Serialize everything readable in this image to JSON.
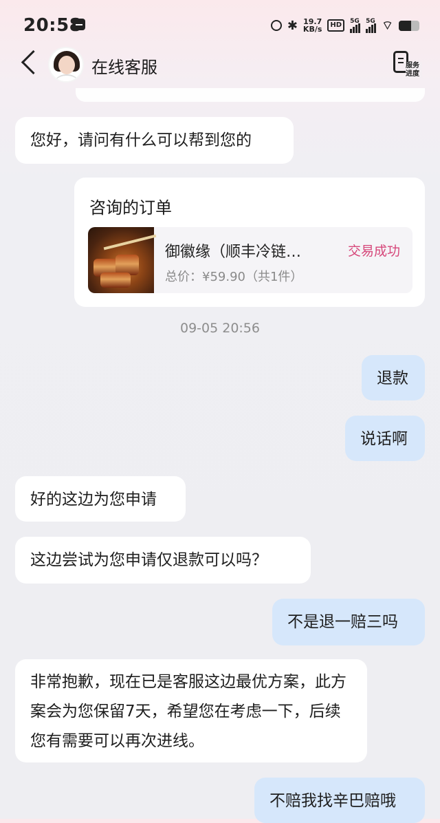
{
  "status_bar": {
    "time": "20:58",
    "net_speed": "19.7",
    "net_unit": "KB/s",
    "hd": "HD",
    "sim1": "5G",
    "sim2": "5G",
    "battery_level": 0.6
  },
  "header": {
    "title": "在线客服",
    "service_progress": "服务进度"
  },
  "messages": [
    {
      "side": "left",
      "text": "您好，请问有什么可以帮到您的"
    },
    {
      "side": "right",
      "text": "退款"
    },
    {
      "side": "right",
      "text": "说话啊"
    },
    {
      "side": "left",
      "text": "好的这边为您申请"
    },
    {
      "side": "left",
      "text": "这边尝试为您申请仅退款可以吗？"
    },
    {
      "side": "right",
      "text": "不是退一赔三吗"
    },
    {
      "side": "left",
      "text": "非常抱歉，现在已是客服这边最优方案，此方案会为您保留7天，希望您在考虑一下，后续您有需要可以再次进线。"
    },
    {
      "side": "right",
      "text": "不赔我找辛巴赔哦"
    }
  ],
  "order_card": {
    "title": "咨询的订单",
    "product_name": "御徽缘（顺丰冷链…",
    "price": "总价：¥59.90（共1件）",
    "status": "交易成功"
  },
  "timestamp": "09-05 20:56",
  "icons": {
    "back": "chevron-left-icon",
    "service": "document-icon"
  }
}
